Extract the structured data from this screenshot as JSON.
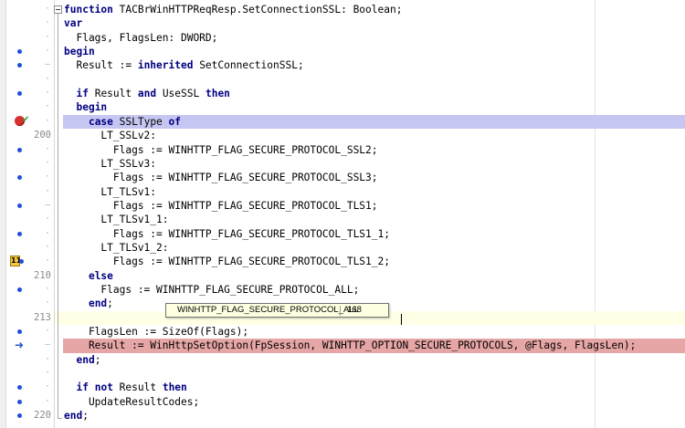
{
  "lines": [
    {
      "n": "",
      "dot": false,
      "marker": "",
      "fold": "open",
      "hl": "",
      "segs": [
        {
          "k": 1,
          "t": "function"
        },
        {
          "k": 0,
          "t": " TACBrWinHTTPReqResp.SetConnectionSSL: Boolean;"
        }
      ]
    },
    {
      "n": "",
      "dot": false,
      "marker": "",
      "fold": "",
      "hl": "",
      "segs": [
        {
          "k": 1,
          "t": "var"
        }
      ]
    },
    {
      "n": "",
      "dot": false,
      "marker": "",
      "fold": "",
      "hl": "",
      "segs": [
        {
          "k": 0,
          "t": "  Flags, FlagsLen: DWORD;"
        }
      ]
    },
    {
      "n": "",
      "dot": true,
      "marker": "",
      "fold": "",
      "hl": "",
      "segs": [
        {
          "k": 1,
          "t": "begin"
        }
      ]
    },
    {
      "n": "",
      "dot": true,
      "marker": "",
      "fold": "",
      "hl": "",
      "segs": [
        {
          "k": 0,
          "t": "  Result := "
        },
        {
          "k": 1,
          "t": "inherited"
        },
        {
          "k": 0,
          "t": " SetConnectionSSL;"
        }
      ]
    },
    {
      "n": "",
      "dot": false,
      "marker": "",
      "fold": "",
      "hl": "",
      "segs": []
    },
    {
      "n": "",
      "dot": true,
      "marker": "",
      "fold": "",
      "hl": "",
      "segs": [
        {
          "k": 0,
          "t": "  "
        },
        {
          "k": 1,
          "t": "if"
        },
        {
          "k": 0,
          "t": " Result "
        },
        {
          "k": 1,
          "t": "and"
        },
        {
          "k": 0,
          "t": " UseSSL "
        },
        {
          "k": 1,
          "t": "then"
        }
      ]
    },
    {
      "n": "",
      "dot": false,
      "marker": "",
      "fold": "",
      "hl": "",
      "segs": [
        {
          "k": 0,
          "t": "  "
        },
        {
          "k": 1,
          "t": "begin"
        }
      ]
    },
    {
      "n": "",
      "dot": false,
      "marker": "breakpoint",
      "fold": "",
      "hl": "blue",
      "segs": [
        {
          "k": 0,
          "t": "    "
        },
        {
          "k": 1,
          "t": "case"
        },
        {
          "k": 0,
          "t": " SSLType "
        },
        {
          "k": 1,
          "t": "of"
        }
      ]
    },
    {
      "n": "200",
      "dot": false,
      "marker": "",
      "fold": "",
      "hl": "",
      "segs": [
        {
          "k": 0,
          "t": "      LT_SSLv2:"
        }
      ]
    },
    {
      "n": "",
      "dot": true,
      "marker": "",
      "fold": "",
      "hl": "",
      "segs": [
        {
          "k": 0,
          "t": "        Flags := WINHTTP_FLAG_SECURE_PROTOCOL_SSL2;"
        }
      ]
    },
    {
      "n": "",
      "dot": false,
      "marker": "",
      "fold": "",
      "hl": "",
      "segs": [
        {
          "k": 0,
          "t": "      LT_SSLv3:"
        }
      ]
    },
    {
      "n": "",
      "dot": true,
      "marker": "",
      "fold": "",
      "hl": "",
      "segs": [
        {
          "k": 0,
          "t": "        Flags := WINHTTP_FLAG_SECURE_PROTOCOL_SSL3;"
        }
      ]
    },
    {
      "n": "",
      "dot": false,
      "marker": "",
      "fold": "",
      "hl": "",
      "segs": [
        {
          "k": 0,
          "t": "      LT_TLSv1:"
        }
      ]
    },
    {
      "n": "",
      "dot": true,
      "marker": "",
      "fold": "",
      "hl": "",
      "segs": [
        {
          "k": 0,
          "t": "        Flags := WINHTTP_FLAG_SECURE_PROTOCOL_TLS1;"
        }
      ]
    },
    {
      "n": "",
      "dot": false,
      "marker": "",
      "fold": "",
      "hl": "",
      "segs": [
        {
          "k": 0,
          "t": "      LT_TLSv1_1:"
        }
      ]
    },
    {
      "n": "",
      "dot": true,
      "marker": "",
      "fold": "",
      "hl": "",
      "segs": [
        {
          "k": 0,
          "t": "        Flags := WINHTTP_FLAG_SECURE_PROTOCOL_TLS1_1;"
        }
      ]
    },
    {
      "n": "",
      "dot": false,
      "marker": "",
      "fold": "",
      "hl": "",
      "segs": [
        {
          "k": 0,
          "t": "      LT_TLSv1_2:"
        }
      ]
    },
    {
      "n": "",
      "dot": true,
      "marker": "bookmark",
      "fold": "",
      "hl": "",
      "segs": [
        {
          "k": 0,
          "t": "        Flags := WINHTTP_FLAG_SECURE_PROTOCOL_TLS1_2;"
        }
      ]
    },
    {
      "n": "210",
      "dot": false,
      "marker": "",
      "fold": "",
      "hl": "",
      "segs": [
        {
          "k": 0,
          "t": "    "
        },
        {
          "k": 1,
          "t": "else"
        }
      ]
    },
    {
      "n": "",
      "dot": true,
      "marker": "",
      "fold": "",
      "hl": "",
      "segs": [
        {
          "k": 0,
          "t": "      Flags := WINHTTP_FLAG_SECURE_PROTOCOL_ALL;"
        }
      ]
    },
    {
      "n": "",
      "dot": false,
      "marker": "",
      "fold": "",
      "hl": "",
      "segs": [
        {
          "k": 0,
          "t": "    "
        },
        {
          "k": 1,
          "t": "end"
        },
        {
          "k": 0,
          "t": ";"
        }
      ]
    },
    {
      "n": "213",
      "dot": false,
      "marker": "",
      "fold": "",
      "hl": "yellow",
      "segs": []
    },
    {
      "n": "",
      "dot": true,
      "marker": "",
      "fold": "",
      "hl": "",
      "segs": [
        {
          "k": 0,
          "t": "    FlagsLen := SizeOf(Flags);"
        }
      ]
    },
    {
      "n": "",
      "dot": true,
      "marker": "exec",
      "fold": "",
      "hl": "red",
      "segs": [
        {
          "k": 0,
          "t": "    Result := WinHttpSetOption(FpSession, WINHTTP_OPTION_SECURE_PROTOCOLS, @Flags, FlagsLen);"
        }
      ]
    },
    {
      "n": "",
      "dot": false,
      "marker": "",
      "fold": "",
      "hl": "",
      "segs": [
        {
          "k": 0,
          "t": "  "
        },
        {
          "k": 1,
          "t": "end"
        },
        {
          "k": 0,
          "t": ";"
        }
      ]
    },
    {
      "n": "",
      "dot": false,
      "marker": "",
      "fold": "",
      "hl": "",
      "segs": []
    },
    {
      "n": "",
      "dot": true,
      "marker": "",
      "fold": "",
      "hl": "",
      "segs": [
        {
          "k": 0,
          "t": "  "
        },
        {
          "k": 1,
          "t": "if"
        },
        {
          "k": 0,
          "t": " "
        },
        {
          "k": 1,
          "t": "not"
        },
        {
          "k": 0,
          "t": " Result "
        },
        {
          "k": 1,
          "t": "then"
        }
      ]
    },
    {
      "n": "",
      "dot": true,
      "marker": "",
      "fold": "",
      "hl": "",
      "segs": [
        {
          "k": 0,
          "t": "    UpdateResultCodes;"
        }
      ]
    },
    {
      "n": "220",
      "dot": true,
      "marker": "",
      "fold": "end",
      "hl": "",
      "segs": [
        {
          "k": 1,
          "t": "end"
        },
        {
          "k": 0,
          "t": ";"
        }
      ]
    }
  ],
  "tooltip": {
    "name": "WINHTTP_FLAG_SECURE_PROTOCOL_ALL",
    "value": "168"
  },
  "bookmark_label": "11",
  "colors": {
    "keyword": "#000080",
    "breakpoint_line": "#c6c6f2",
    "exec_line": "#e7a6a6",
    "current_line": "#ffffe6",
    "gutter_dot": "#1f4fd8"
  }
}
